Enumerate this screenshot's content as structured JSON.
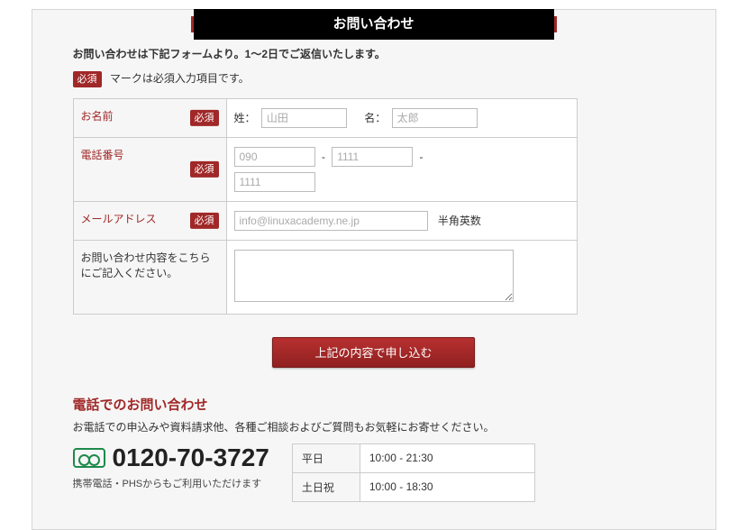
{
  "header": {
    "title": "お問い合わせ"
  },
  "intro": "お問い合わせは下記フォームより。1〜2日でご返信いたします。",
  "required_badge": "必須",
  "required_note": "マークは必須入力項目です。",
  "form": {
    "name": {
      "label": "お名前",
      "last_label": "姓：",
      "last_placeholder": "山田",
      "first_label": "名：",
      "first_placeholder": "太郎"
    },
    "phone": {
      "label": "電話番号",
      "p1_placeholder": "090",
      "p2_placeholder": "1111",
      "p3_placeholder": "1111"
    },
    "email": {
      "label": "メールアドレス",
      "placeholder": "info@linuxacademy.ne.jp",
      "note": "半角英数"
    },
    "message": {
      "label": "お問い合わせ内容をこちらにご記入ください。"
    },
    "submit": "上記の内容で申し込む"
  },
  "phone_section": {
    "title": "電話でのお問い合わせ",
    "desc": "お電話での申込みや資料請求他、各種ご相談およびご質問もお気軽にお寄せください。",
    "number": "0120-70-3727",
    "subnote": "携帯電話・PHSからもご利用いただけます",
    "hours": {
      "weekday_label": "平日",
      "weekday_hours": "10:00 - 21:30",
      "weekend_label": "土日祝",
      "weekend_hours": "10:00 - 18:30"
    }
  }
}
